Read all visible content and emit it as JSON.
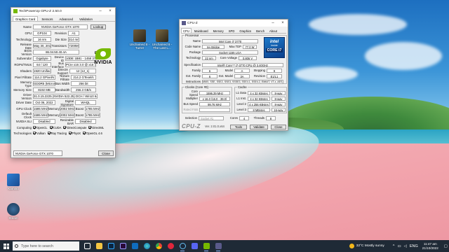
{
  "desktop": {
    "icons": [
      {
        "name": "Kamino",
        "label": "Kamino"
      },
      {
        "name": "Steam",
        "label": "Steam"
      },
      {
        "name": "OneWorld 8 Spinner",
        "label": "Unchained 8 - Turrer"
      },
      {
        "name": "OneWorld 8 Stat",
        "label": "Unchained 8 - The Last L..."
      }
    ]
  },
  "gpuz": {
    "title": "TechPowerUp GPU-Z 2.50.0",
    "tabs": [
      "Graphics Card",
      "Sensors",
      "Advanced",
      "Validation"
    ],
    "lookup_label": "Lookup",
    "logo_text": "NVIDIA",
    "uefi_label": "UEFI",
    "rows": {
      "name": {
        "label": "Name",
        "value": "NVIDIA GeForce GTX 1070"
      },
      "gpu": {
        "label": "GPU",
        "value": "GP104",
        "label2": "Revision",
        "value2": "A1"
      },
      "technology": {
        "label": "Technology",
        "value": "16 nm",
        "label2": "Die Size",
        "value2": "314 mm²"
      },
      "release_date": {
        "label": "Release Date",
        "value": "May 30, 2016",
        "label2": "Transistors",
        "value2": "7200M"
      },
      "bios": {
        "label": "BIOS Version",
        "value": "86.04.50.40.4A"
      },
      "subvendor": {
        "label": "Subvendor",
        "value": "Gigabyte",
        "label2": "Device ID",
        "value2": "10DE 1B81 - 1458 3772"
      },
      "rops": {
        "label": "ROPs/TMUs",
        "value": "64 / 120",
        "label2": "Bus Interface",
        "value2": "PCIe x16 3.0 @ x16 3.0"
      },
      "shaders": {
        "label": "Shaders",
        "value": "1920 Unified",
        "label2": "DirectX Support",
        "value2": "12 (12_1)"
      },
      "pixel_fill": {
        "label": "Pixel Fillrate",
        "value": "114.2 GPixel/s",
        "label2": "Texture Fillrate",
        "value2": "214.2 GTexel/s"
      },
      "mem_type": {
        "label": "Memory Type",
        "value": "GDDR5 (Micron)",
        "label2": "Bus Width",
        "value2": "256 bit"
      },
      "mem_size": {
        "label": "Memory Size",
        "value": "8192 MB",
        "label2": "Bandwidth",
        "value2": "256.3 GB/s"
      },
      "driver_version": {
        "label": "Driver Version",
        "value": "31.0.15.2225 (NVIDIA 522.25) DCH / Win10 64"
      },
      "driver_date": {
        "label": "Driver Date",
        "value": "Oct 06, 2022",
        "label2": "Digital Signature",
        "value2": "WHQL"
      },
      "gpu_clock": {
        "label": "GPU Clock",
        "value": "1595 MHz",
        "label2": "Memory",
        "value2": "2002 MHz",
        "label3": "Boost",
        "value3": "1785 MHz"
      },
      "default_clock": {
        "label": "Default Clock",
        "value": "1595 MHz",
        "label2": "Memory",
        "value2": "2002 MHz",
        "label3": "Boost",
        "value3": "1785 MHz"
      },
      "sli": {
        "label": "NVIDIA SLI",
        "value": "Disabled",
        "label2": "Resizable BAR",
        "value2": "Disabled"
      }
    },
    "computing_label": "Computing",
    "computing": [
      "OpenCL",
      "CUDA",
      "DirectCompute",
      "DirectML"
    ],
    "technologies_label": "Technologies",
    "technologies": [
      "Vulkan",
      "Ray Tracing",
      "PhysX",
      "OpenGL 4.6"
    ],
    "selected_gpu": "NVIDIA GeForce GTX 1070",
    "close_label": "Close"
  },
  "cpuz": {
    "title": "CPU-Z",
    "tabs": [
      "CPU",
      "Mainboard",
      "Memory",
      "SPD",
      "Graphics",
      "Bench",
      "About"
    ],
    "processor_title": "Processor",
    "name": {
      "label": "Name",
      "value": "Intel Core i7 3770"
    },
    "code_name": {
      "label": "Code Name",
      "value": "Ivy Bridge",
      "label2": "Max TDP",
      "value2": "77.0 W"
    },
    "package": {
      "label": "Package",
      "value": "Socket 1155 LGA"
    },
    "technology": {
      "label": "Technology",
      "value": "22 nm",
      "label2": "Core Voltage",
      "value2": "0.806 V"
    },
    "specification": {
      "label": "Specification",
      "value": "Intel® Core™ i7-3770 CPU @ 3.40GHz"
    },
    "family": {
      "label": "Family",
      "value": "6",
      "label2": "Model",
      "value2": "A",
      "label3": "Stepping",
      "value3": "9"
    },
    "ext_family": {
      "label": "Ext. Family",
      "value": "6",
      "label2": "Ext. Model",
      "value2": "3A",
      "label3": "Revision",
      "value3": "E1/L1"
    },
    "instructions": {
      "label": "Instructions",
      "value": "MMX, SSE, SSE2, SSE3, SSSE3, SSE4.1, SSE4.2, EM64T, VT-x, AES, AVX"
    },
    "intel_badge": {
      "brand": "intel",
      "sub": "inside",
      "line": "CORE i7"
    },
    "clocks_title": "Clocks (Core #0)",
    "core_speed": {
      "label": "Core Speed",
      "value": "1596.39 MHz"
    },
    "multiplier": {
      "label": "Multiplier",
      "value": "x 16.0 (16.0 - 39.0)"
    },
    "bus_speed": {
      "label": "Bus Speed",
      "value": "99.76 MHz"
    },
    "rated_fsb": {
      "label": "Rated FSB",
      "value": ""
    },
    "cache_title": "Cache",
    "l1d": {
      "label": "L1 Data",
      "value": "4 x 32 KBytes",
      "way": "8-way"
    },
    "l1i": {
      "label": "L1 Inst.",
      "value": "4 x 32 KBytes",
      "way": "8-way"
    },
    "l2": {
      "label": "Level 2",
      "value": "4 x 256 KBytes",
      "way": "8-way"
    },
    "l3": {
      "label": "Level 3",
      "value": "8 MBytes",
      "way": "16-way"
    },
    "selection_label": "Selection",
    "selection_value": "Socket #1",
    "cores_label": "Cores",
    "cores_value": "4",
    "threads_label": "Threads",
    "threads_value": "8",
    "logo": "CPU-Z",
    "version": "Ver. 2.01.0.x64",
    "tools_label": "Tools",
    "validate_label": "Validate",
    "close_label": "Close"
  },
  "taskbar": {
    "search_placeholder": "Type here to search",
    "apps": [
      "task-view",
      "file-explorer",
      "photoshop",
      "premiere",
      "mail",
      "edge",
      "chrome",
      "opera",
      "steam",
      "discord",
      "gpu-z",
      "cpu-z"
    ],
    "weather_temp": "32°C",
    "weather_text": "Mostly sunny",
    "time": "11:47 am",
    "date": "21/10/2022",
    "language": "ENG"
  },
  "colors": {
    "nvidia_green": "#76b900",
    "taskbar": "#1f2a36",
    "intel_blue": "#1d79c9"
  }
}
